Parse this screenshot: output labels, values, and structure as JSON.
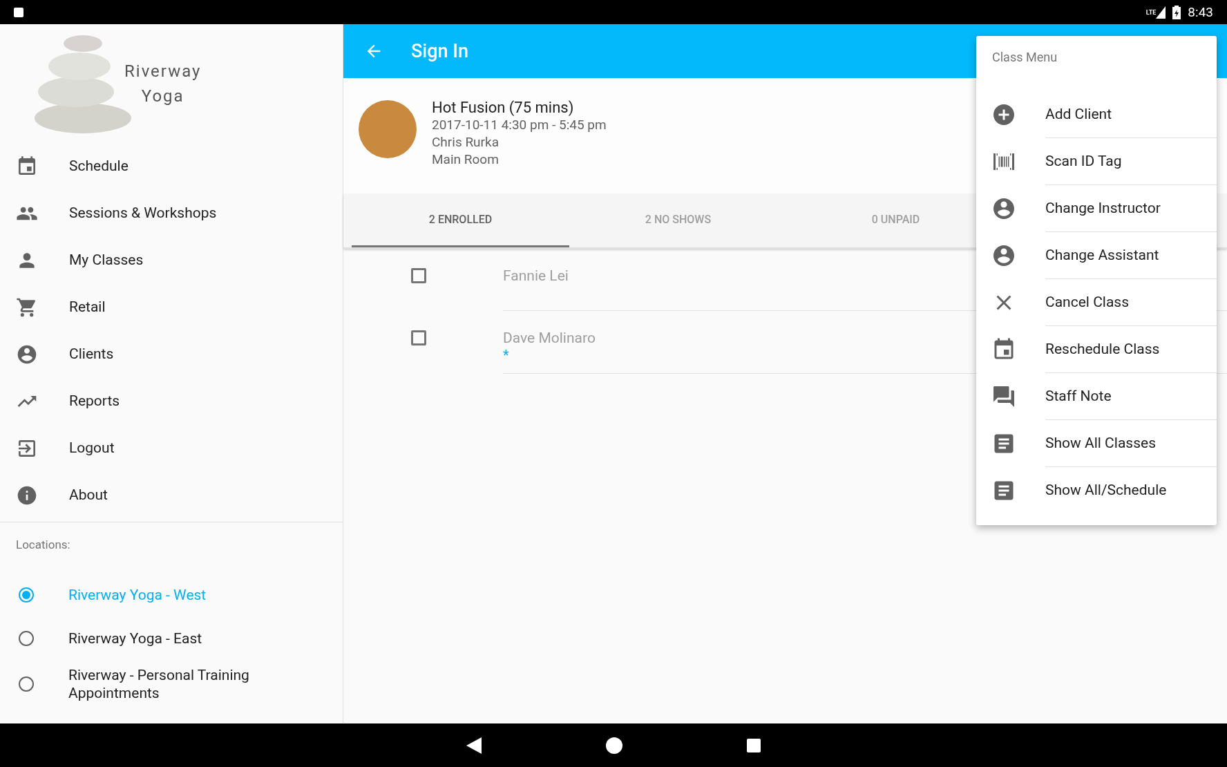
{
  "status_bar": {
    "network": "LTE",
    "time": "8:43"
  },
  "sidebar": {
    "logo": {
      "line_1": "Riverway",
      "line_2": "Yoga"
    },
    "items": [
      {
        "kind": "calendar",
        "label": "Schedule"
      },
      {
        "kind": "people",
        "label": "Sessions & Workshops"
      },
      {
        "kind": "person",
        "label": "My Classes"
      },
      {
        "kind": "cart",
        "label": "Retail"
      },
      {
        "kind": "account",
        "label": "Clients"
      },
      {
        "kind": "trend",
        "label": "Reports"
      },
      {
        "kind": "exit",
        "label": "Logout"
      },
      {
        "kind": "info",
        "label": "About"
      }
    ],
    "locations_title": "Locations:",
    "locations": [
      {
        "label": "Riverway Yoga - West",
        "selected": true
      },
      {
        "label": "Riverway Yoga - East",
        "selected": false
      },
      {
        "label": "Riverway - Personal Training Appointments",
        "selected": false
      }
    ]
  },
  "app_bar": {
    "title": "Sign In"
  },
  "class_info": {
    "name": "Hot Fusion (75 mins)",
    "time": "2017-10-11 4:30 pm - 5:45 pm",
    "instructor": "Chris Rurka",
    "room": "Main Room"
  },
  "tabs": [
    {
      "label": "2 ENROLLED",
      "selected": true
    },
    {
      "label": "2 NO SHOWS",
      "selected": false
    },
    {
      "label": "0 UNPAID",
      "selected": false
    }
  ],
  "clients": [
    {
      "name": "Fannie Lei",
      "checked": false
    },
    {
      "name": "Dave Molinaro",
      "checked": false,
      "note": "*"
    }
  ],
  "class_menu": {
    "title": "Class Menu",
    "items": [
      {
        "kind": "add",
        "label": "Add Client"
      },
      {
        "kind": "barcode",
        "label": "Scan ID Tag"
      },
      {
        "kind": "account",
        "label": "Change Instructor"
      },
      {
        "kind": "account",
        "label": "Change Assistant"
      },
      {
        "kind": "close",
        "label": "Cancel Class"
      },
      {
        "kind": "calendar",
        "label": "Reschedule Class"
      },
      {
        "kind": "chat",
        "label": "Staff Note"
      },
      {
        "kind": "doc",
        "label": "Show All Classes"
      },
      {
        "kind": "doc",
        "label": "Show All/Schedule"
      }
    ]
  }
}
